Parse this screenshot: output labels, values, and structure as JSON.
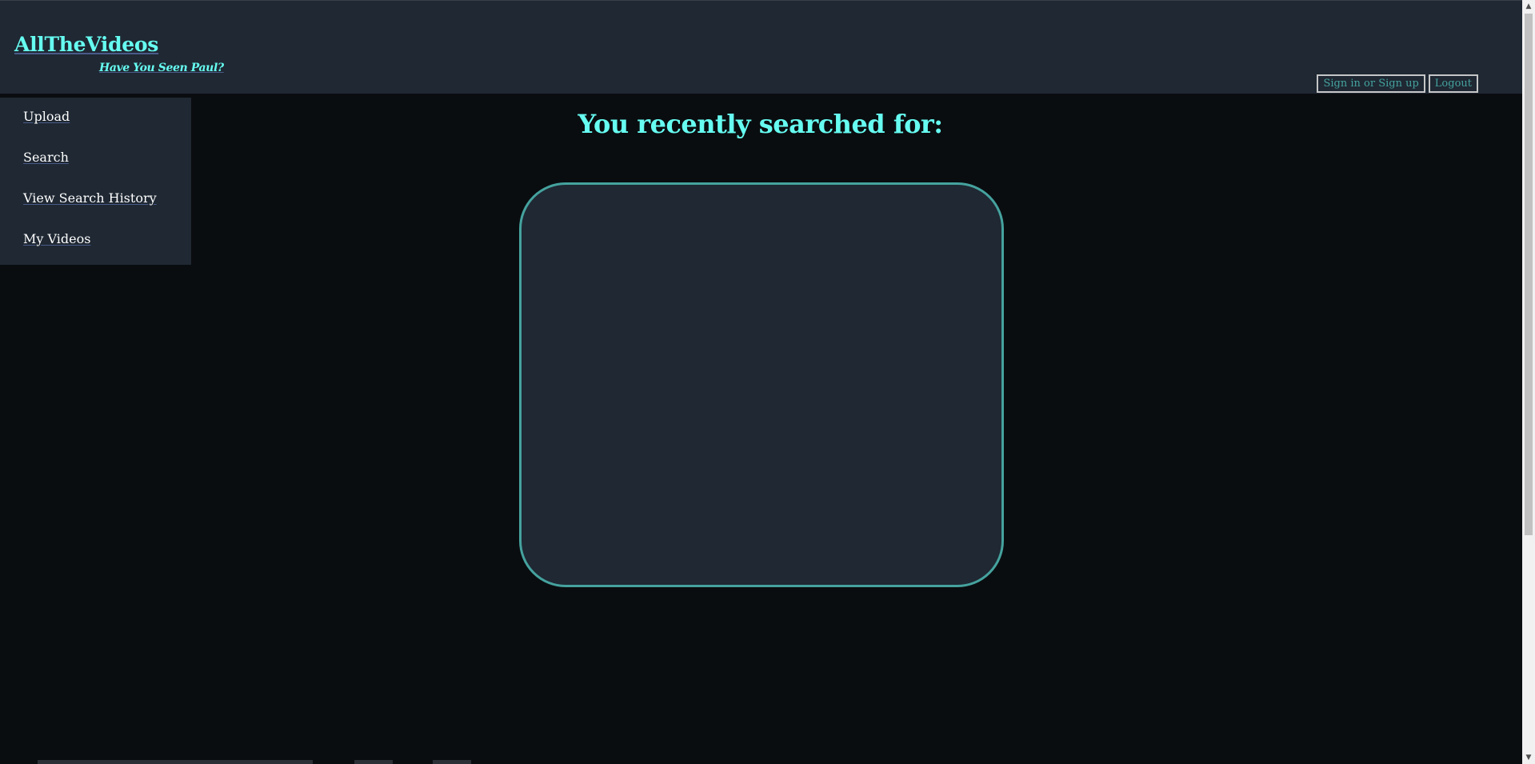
{
  "header": {
    "brand": "AllTheVideos",
    "tagline": "Have You Seen Paul?",
    "auth": {
      "sign_in_label": "Sign in or Sign up",
      "logout_label": "Logout"
    }
  },
  "sidebar": {
    "items": [
      {
        "label": "Upload"
      },
      {
        "label": "Search"
      },
      {
        "label": "View Search History"
      },
      {
        "label": "My Videos"
      }
    ]
  },
  "main": {
    "title": "You recently searched for:"
  },
  "scrollbar": {
    "up_icon": "triangle-up-icon",
    "down_icon": "triangle-down-icon"
  },
  "colors": {
    "accent": "#66fcf1",
    "secondary": "#45a29e",
    "panel": "#1f2833",
    "background": "#0a0d10",
    "text": "#ffffff"
  }
}
